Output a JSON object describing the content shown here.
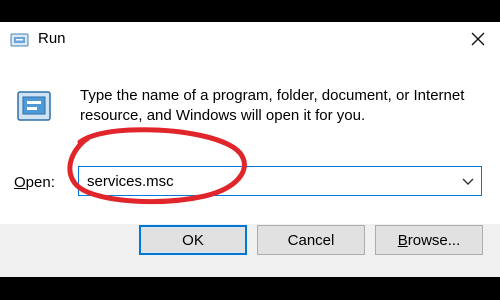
{
  "window": {
    "title": "Run",
    "icon": "run-dialog-icon",
    "close_icon": "close-icon"
  },
  "content": {
    "icon": "run-program-icon",
    "description": "Type the name of a program, folder, document, or Internet resource, and Windows will open it for you."
  },
  "open_field": {
    "label_accel": "O",
    "label_rest": "pen:",
    "value": "services.msc",
    "dropdown_icon": "chevron-down-icon"
  },
  "buttons": {
    "ok": "OK",
    "cancel": "Cancel",
    "browse_accel": "B",
    "browse_rest": "rowse..."
  },
  "annotation": {
    "shape": "freehand-ellipse",
    "color": "#e0262b"
  },
  "colors": {
    "focus_border": "#0078d7",
    "footer_bg": "#f0f0f0",
    "button_bg": "#e1e1e1"
  }
}
